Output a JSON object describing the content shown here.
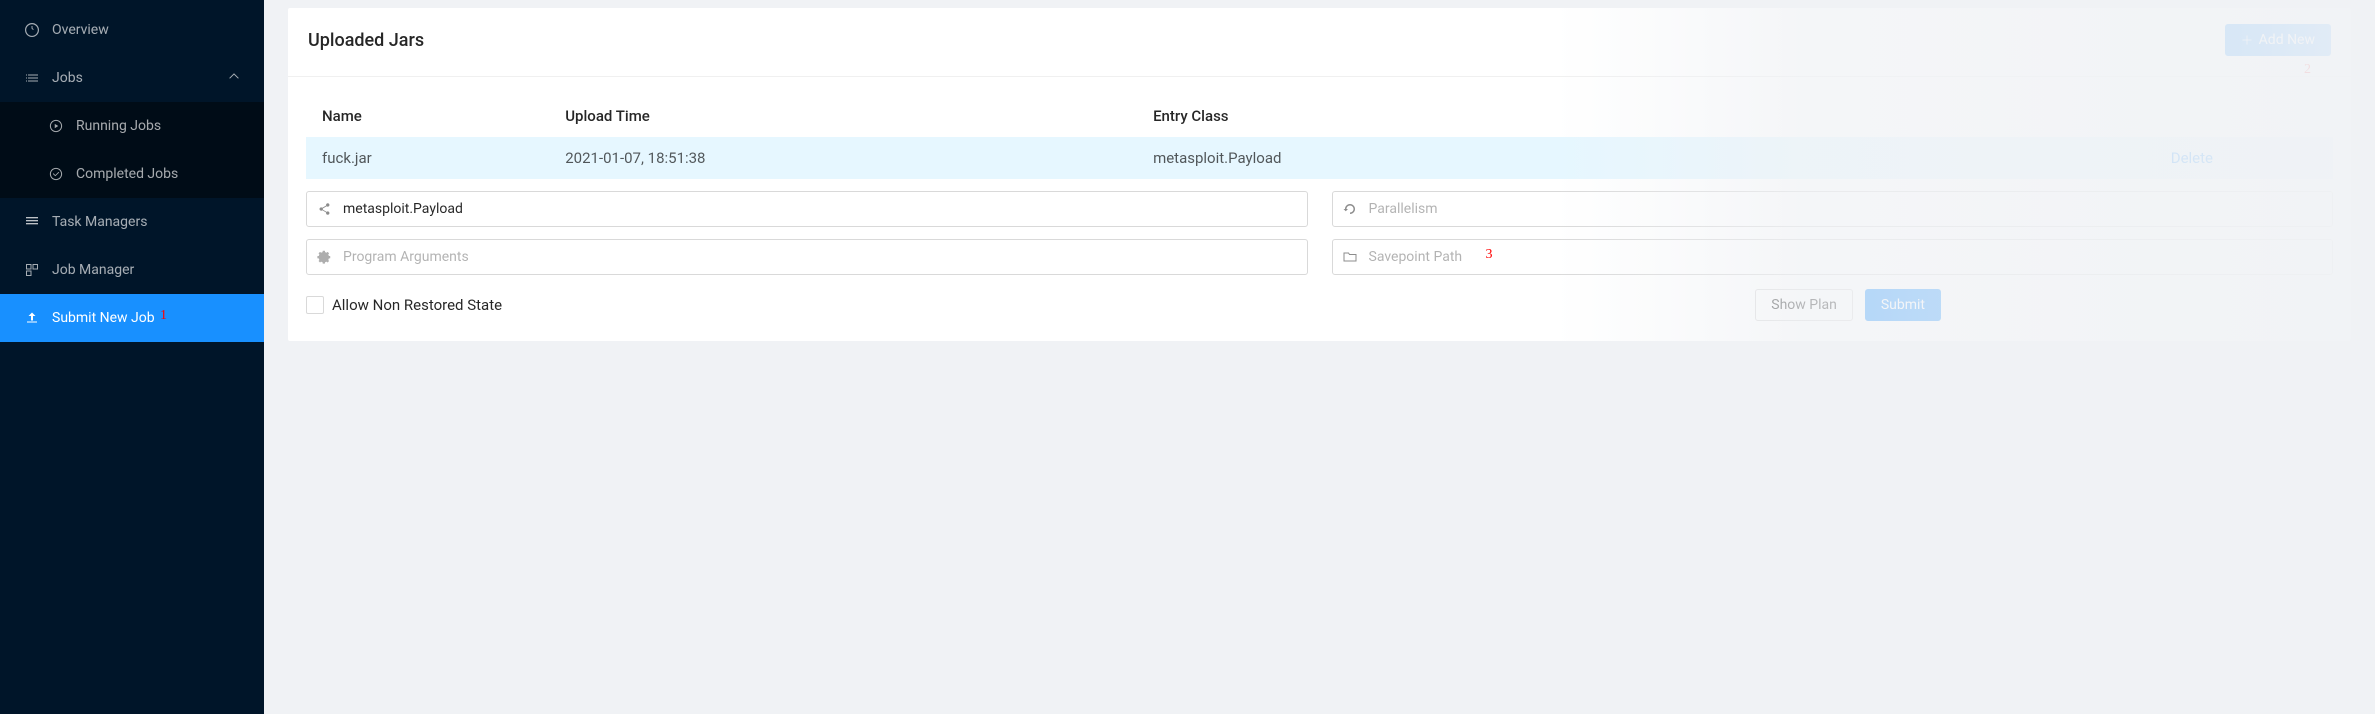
{
  "sidebar": {
    "items": [
      {
        "label": "Overview"
      },
      {
        "label": "Jobs",
        "expanded": true,
        "children": [
          {
            "label": "Running Jobs"
          },
          {
            "label": "Completed Jobs"
          }
        ]
      },
      {
        "label": "Task Managers"
      },
      {
        "label": "Job Manager"
      },
      {
        "label": "Submit New Job",
        "active": true
      }
    ]
  },
  "card": {
    "title": "Uploaded Jars",
    "add_button": "Add New"
  },
  "table": {
    "headers": {
      "name": "Name",
      "upload_time": "Upload Time",
      "entry_class": "Entry Class"
    },
    "rows": [
      {
        "name": "fuck.jar",
        "upload_time": "2021-01-07, 18:51:38",
        "entry_class": "metasploit.Payload",
        "action": "Delete"
      }
    ]
  },
  "form": {
    "entry_class_value": "metasploit.Payload",
    "parallelism_placeholder": "Parallelism",
    "program_args_placeholder": "Program Arguments",
    "savepoint_placeholder": "Savepoint Path",
    "allow_non_restored": "Allow Non Restored State",
    "show_plan": "Show Plan",
    "submit": "Submit"
  },
  "annotations": {
    "a1": "1",
    "a2": "2",
    "a3": "3"
  }
}
